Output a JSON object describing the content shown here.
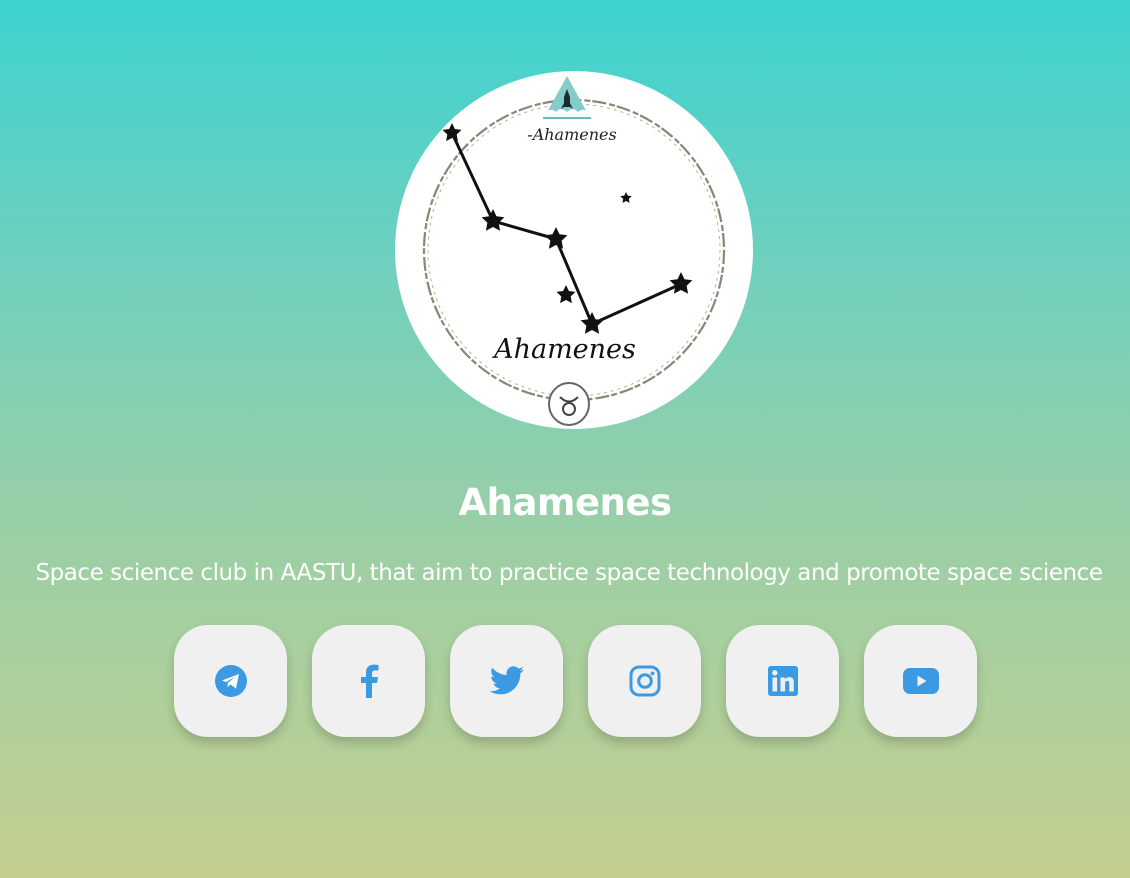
{
  "logo": {
    "alt": "Ahamenes logo",
    "top_text": "-Ahamenes",
    "main_text": "Ahamenes"
  },
  "title": "Ahamenes",
  "tagline": "Space science club in AASTU, that aim to practice space technology and promote space science",
  "socials": [
    {
      "name": "Telegram",
      "icon": "telegram-icon"
    },
    {
      "name": "Facebook",
      "icon": "facebook-icon"
    },
    {
      "name": "Twitter",
      "icon": "twitter-icon"
    },
    {
      "name": "Instagram",
      "icon": "instagram-icon"
    },
    {
      "name": "LinkedIn",
      "icon": "linkedin-icon"
    },
    {
      "name": "YouTube",
      "icon": "youtube-icon"
    }
  ],
  "colors": {
    "icon": "#3b9ae1",
    "button_bg": "#f0f0f0",
    "gradient_top": "#3dd2d0",
    "gradient_bottom": "#c4cf8f",
    "text": "#ffffff"
  }
}
